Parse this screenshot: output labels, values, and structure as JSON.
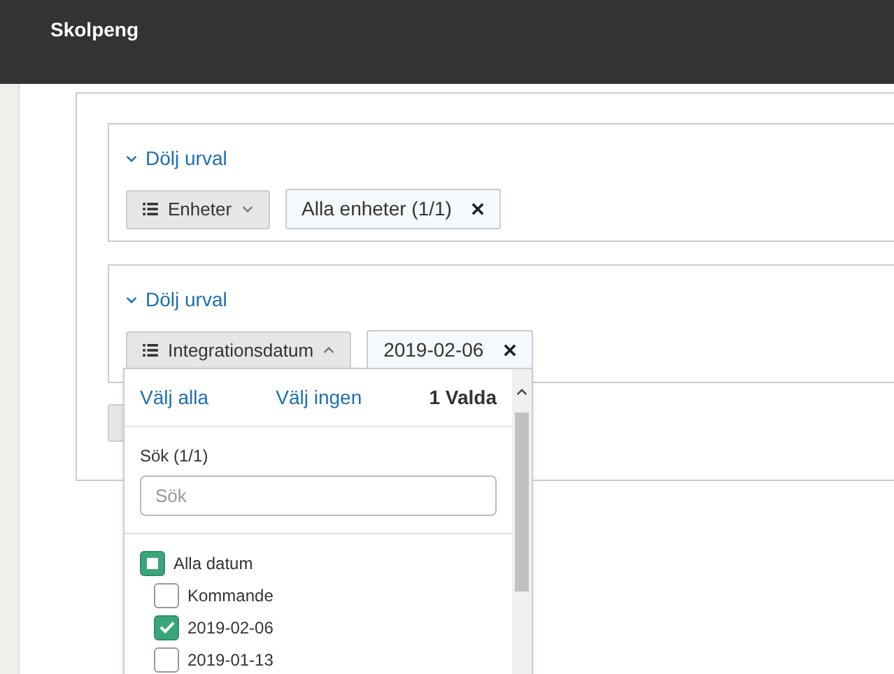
{
  "header": {
    "title": "Skolpeng"
  },
  "filter_groups": [
    {
      "toggle": "Dölj urval",
      "button": "Enheter",
      "expanded": false,
      "chip": "Alla enheter (1/1)"
    },
    {
      "toggle": "Dölj urval",
      "button": "Integrationsdatum",
      "expanded": true,
      "chip": "2019-02-06"
    }
  ],
  "dropdown": {
    "select_all": "Välj alla",
    "select_none": "Välj ingen",
    "count": "1 Valda",
    "search_label": "Sök (1/1)",
    "search": {
      "placeholder": "Sök"
    },
    "tree": [
      {
        "label": "Alla datum",
        "indeterminate": true,
        "children": [
          {
            "label": "Kommande",
            "checked": false
          },
          {
            "label": "2019-02-06",
            "checked": true
          },
          {
            "label": "2019-01-13",
            "checked": false
          }
        ]
      }
    ]
  }
}
